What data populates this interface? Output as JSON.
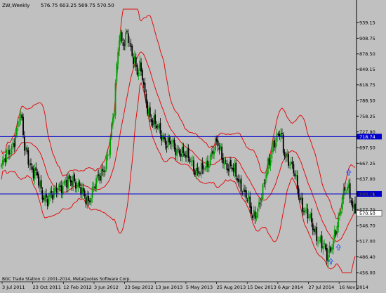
{
  "header": {
    "symbol_label": "ZW,Weekly",
    "ohlc_label": "576.75 603.25 569.75 570.50"
  },
  "footer": {
    "copyright_text": "BGC Trade Station © 2001-2014, MetaQuotes Software Corp."
  },
  "colors": {
    "background": "#c0c0c0",
    "bar_up": "#00a000",
    "bar_down": "#000000",
    "bands": "#e01010",
    "hline": "#0000cc",
    "current_price_tag": "#ffffff",
    "arrow": "#2a4cff"
  },
  "chart_data": {
    "type": "candlestick",
    "timeframe": "Weekly",
    "symbol": "ZW",
    "last": {
      "open": 576.75,
      "high": 603.25,
      "low": 569.75,
      "close": 570.5
    },
    "y_axis": {
      "ticks": [
        939.15,
        908.75,
        878.5,
        849.15,
        818.75,
        788.5,
        758.25,
        727.9,
        697.5,
        667.25,
        637.0,
        608.0,
        577.7,
        546.7,
        517.0,
        486.4,
        456.0
      ],
      "ylim": [
        456,
        965
      ]
    },
    "x_axis": {
      "ticks": [
        "3 Jul 2011",
        "23 Oct 2011",
        "12 Feb 2012",
        "3 Jun 2012",
        "23 Sep 2012",
        "13 Jan 2013",
        "5 May 2013",
        "25 Aug 2013",
        "15 Dec 2013",
        "6 Apr 2014",
        "27 Jul 2014",
        "16 Nov 2014"
      ]
    },
    "horizontal_lines": [
      {
        "price": 718.74,
        "label": "718.74"
      },
      {
        "price": 608.01,
        "label": "608.01"
      }
    ],
    "current_price_label": "570.50",
    "close_path": [
      [
        0,
        660
      ],
      [
        4,
        680
      ],
      [
        8,
        700
      ],
      [
        12,
        730
      ],
      [
        14,
        755
      ],
      [
        16,
        745
      ],
      [
        18,
        700
      ],
      [
        20,
        690
      ],
      [
        24,
        650
      ],
      [
        28,
        640
      ],
      [
        32,
        610
      ],
      [
        36,
        595
      ],
      [
        40,
        605
      ],
      [
        44,
        625
      ],
      [
        48,
        620
      ],
      [
        52,
        630
      ],
      [
        56,
        640
      ],
      [
        60,
        620
      ],
      [
        64,
        605
      ],
      [
        68,
        598
      ],
      [
        72,
        618
      ],
      [
        76,
        640
      ],
      [
        80,
        660
      ],
      [
        84,
        690
      ],
      [
        88,
        770
      ],
      [
        90,
        860
      ],
      [
        92,
        920
      ],
      [
        94,
        905
      ],
      [
        96,
        895
      ],
      [
        98,
        915
      ],
      [
        100,
        895
      ],
      [
        102,
        880
      ],
      [
        104,
        870
      ],
      [
        106,
        845
      ],
      [
        108,
        850
      ],
      [
        110,
        830
      ],
      [
        112,
        795
      ],
      [
        116,
        760
      ],
      [
        120,
        740
      ],
      [
        124,
        725
      ],
      [
        128,
        712
      ],
      [
        132,
        705
      ],
      [
        136,
        690
      ],
      [
        140,
        695
      ],
      [
        144,
        680
      ],
      [
        148,
        670
      ],
      [
        152,
        655
      ],
      [
        156,
        650
      ],
      [
        160,
        660
      ],
      [
        164,
        690
      ],
      [
        168,
        705
      ],
      [
        172,
        680
      ],
      [
        176,
        665
      ],
      [
        180,
        655
      ],
      [
        184,
        640
      ],
      [
        188,
        620
      ],
      [
        192,
        595
      ],
      [
        196,
        565
      ],
      [
        200,
        580
      ],
      [
        204,
        610
      ],
      [
        208,
        665
      ],
      [
        212,
        705
      ],
      [
        216,
        715
      ],
      [
        218,
        725
      ],
      [
        220,
        695
      ],
      [
        224,
        675
      ],
      [
        228,
        650
      ],
      [
        232,
        610
      ],
      [
        236,
        580
      ],
      [
        240,
        560
      ],
      [
        244,
        540
      ],
      [
        248,
        520
      ],
      [
        252,
        500
      ],
      [
        254,
        485
      ],
      [
        256,
        500
      ],
      [
        260,
        530
      ],
      [
        264,
        560
      ],
      [
        266,
        600
      ],
      [
        268,
        620
      ],
      [
        270,
        628
      ],
      [
        272,
        610
      ],
      [
        274,
        575
      ],
      [
        276,
        570
      ]
    ]
  }
}
